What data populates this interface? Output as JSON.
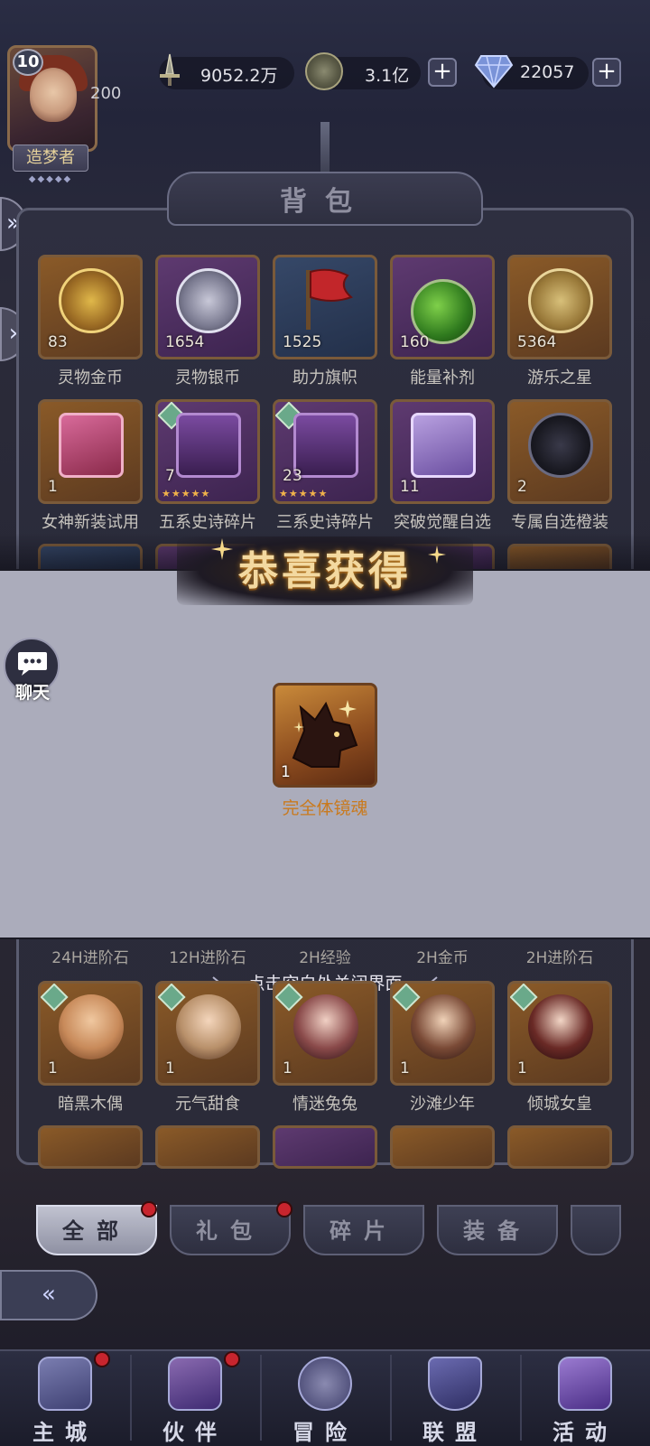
{
  "player": {
    "level": "10",
    "exp": "200",
    "title": "造梦者"
  },
  "resources": {
    "power": "9052.2万",
    "gold": "3.1亿",
    "diamonds": "22057"
  },
  "backpack": {
    "title": "背包",
    "row1": [
      {
        "name": "灵物金币",
        "count": "83",
        "color": "orange",
        "icon": "gold-token-icon"
      },
      {
        "name": "灵物银币",
        "count": "1654",
        "color": "purple",
        "icon": "silver-token-icon"
      },
      {
        "name": "助力旗帜",
        "count": "1525",
        "color": "blue",
        "icon": "flag-icon"
      },
      {
        "name": "能量补剂",
        "count": "160",
        "color": "purple",
        "icon": "potion-icon"
      },
      {
        "name": "游乐之星",
        "count": "5364",
        "color": "orange",
        "icon": "star-coin-icon"
      }
    ],
    "row2": [
      {
        "name": "女神新装试用",
        "count": "1",
        "color": "orange",
        "icon": "gift-box-icon"
      },
      {
        "name": "五系史诗碎片",
        "count": "7",
        "color": "purple",
        "icon": "chest-icon"
      },
      {
        "name": "三系史诗碎片",
        "count": "23",
        "color": "purple",
        "icon": "chest-icon"
      },
      {
        "name": "突破觉醒自选",
        "count": "11",
        "color": "purple",
        "icon": "gift-box-icon"
      },
      {
        "name": "专属自选橙装",
        "count": "2",
        "color": "orange",
        "icon": "amulet-icon"
      }
    ],
    "reward_heads": [
      "24H进阶石",
      "12H进阶石",
      "2H经验",
      "2H金币",
      "2H进阶石"
    ],
    "heroes": [
      {
        "name": "暗黑木偶",
        "count": "1"
      },
      {
        "name": "元气甜食",
        "count": "1"
      },
      {
        "name": "情迷兔兔",
        "count": "1"
      },
      {
        "name": "沙滩少年",
        "count": "1"
      },
      {
        "name": "倾城女皇",
        "count": "1"
      }
    ]
  },
  "popup": {
    "title": "恭喜获得",
    "reward_name": "完全体镜魂",
    "reward_count": "1",
    "close_hint": "点击空白处关闭界面"
  },
  "chat": {
    "label": "聊天"
  },
  "tabs": [
    "全部",
    "礼包",
    "碎片",
    "装备"
  ],
  "nav": [
    "主城",
    "伙伴",
    "冒险",
    "联盟",
    "活动"
  ],
  "colors": {
    "accent_gold": "#f3d9a0",
    "reward_name": "#c97a1e",
    "badge_red": "#c8252e"
  }
}
